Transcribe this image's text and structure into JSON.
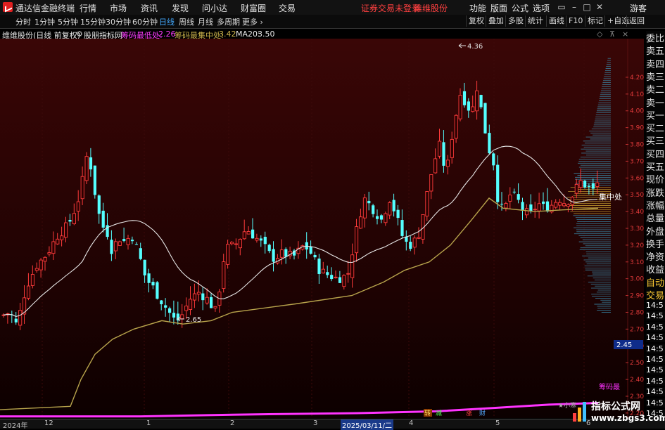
{
  "titlebar": {
    "app_title": "通达信金融终端",
    "menus": [
      "行情",
      "市场",
      "资讯",
      "发现",
      "问小达",
      "财富圈",
      "交易"
    ],
    "notice": "证券交易未登录",
    "stock_name": "维维股份",
    "right_menus": [
      "功能",
      "版面",
      "公式",
      "选项"
    ],
    "user": "游客"
  },
  "periods": [
    "分时",
    "1分钟",
    "5分钟",
    "15分钟",
    "30分钟",
    "60分钟",
    "日线",
    "周线",
    "月线",
    "多周期",
    "更多"
  ],
  "active_period": "日线",
  "right_buttons": [
    "复权",
    "叠加",
    "多股",
    "统计",
    "画线",
    "F10",
    "标记",
    "+自选",
    "返回"
  ],
  "info": {
    "stock": "维维股份(日线 前复权)",
    "indicator": "股朋指标网",
    "low_label": "筹码最低处:",
    "low_value": "2.26",
    "focus_label": "筹码最集中处:",
    "focus_value": "3.42",
    "ma_label": "MA20:",
    "ma_value": "3.50"
  },
  "right_panel": {
    "items": [
      "委比",
      "卖五",
      "卖四",
      "卖三",
      "卖二",
      "卖一",
      "买一",
      "买二",
      "买三",
      "买四",
      "买五",
      "现价",
      "涨跌",
      "涨幅",
      "总量",
      "外盘",
      "换手",
      "净资",
      "收益",
      "自动",
      "交易"
    ],
    "times": [
      "14:5",
      "14:5",
      "14:5",
      "14:5",
      "14:5",
      "14:5",
      "14:5",
      "14:5",
      "14:5",
      "14:5",
      "14:5"
    ]
  },
  "chart_data": {
    "type": "candlestick",
    "y_ticks": [
      "4.20",
      "4.10",
      "4.00",
      "3.90",
      "3.80",
      "3.70",
      "3.60",
      "3.50",
      "3.40",
      "3.30",
      "3.20",
      "3.10",
      "3.00",
      "2.90",
      "2.80",
      "2.70",
      "2.60",
      "2.50",
      "2.40",
      "2.30",
      "2.20"
    ],
    "ylim": [
      2.17,
      4.43
    ],
    "annotations": {
      "high": "4.36",
      "low": "2.65",
      "price_box": "2.45",
      "focus_tag": "集中处",
      "chip_tag": "筹码最",
      "small_tag": "★小寒"
    },
    "x_labels": [
      "2024年",
      "12",
      "1",
      "2",
      "3",
      "2025/03/11/二",
      "4",
      "5",
      "6"
    ],
    "event_tags": [
      "转",
      "减",
      "涨",
      "财"
    ]
  },
  "watermark": {
    "title": "指标公式网",
    "url": "www.zbgs3.com"
  },
  "colors": {
    "up": "#ff3b3b",
    "down": "#54ffff",
    "ma": "#e6e6e6",
    "chip_line": "#b8a44c",
    "pink": "#ff33ff"
  }
}
